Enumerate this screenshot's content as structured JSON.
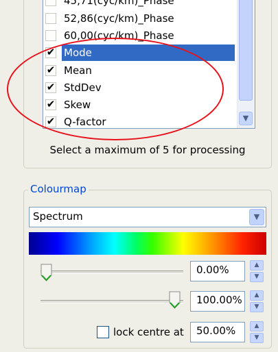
{
  "list": {
    "items": [
      {
        "label": "45,71(cyc/km)_Phase",
        "checked": false,
        "selected": false
      },
      {
        "label": "52,86(cyc/km)_Phase",
        "checked": false,
        "selected": false
      },
      {
        "label": "60,00(cyc/km)_Phase",
        "checked": false,
        "selected": false
      },
      {
        "label": "Mode",
        "checked": true,
        "selected": true
      },
      {
        "label": "Mean",
        "checked": true,
        "selected": false
      },
      {
        "label": "StdDev",
        "checked": true,
        "selected": false
      },
      {
        "label": "Skew",
        "checked": true,
        "selected": false
      },
      {
        "label": "Q-factor",
        "checked": true,
        "selected": false
      }
    ],
    "hint": "Select a maximum of 5 for processing"
  },
  "colourmap": {
    "legend": "Colourmap",
    "selected": "Spectrum",
    "min_value": "0.00%",
    "max_value": "100.00%",
    "lock_label": "lock centre at",
    "lock_checked": false,
    "centre_value": "50.00%",
    "min_slider_fraction": 0.0,
    "max_slider_fraction": 1.0
  },
  "colors": {
    "selection": "#316ac5",
    "annotation": "#e8101a",
    "legend": "#0046d5"
  },
  "icons": [
    "checkmark-icon",
    "chevron-down-icon",
    "chevron-up-icon"
  ]
}
